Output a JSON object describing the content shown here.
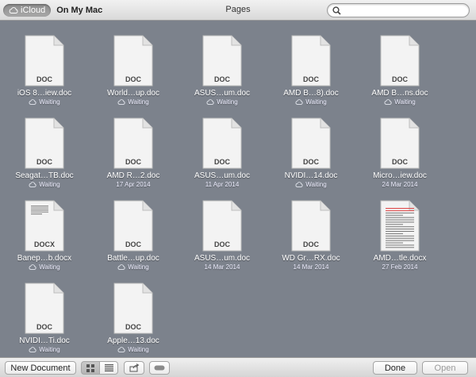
{
  "header": {
    "sources": [
      "iCloud",
      "On My Mac"
    ],
    "title": "Pages",
    "search_placeholder": ""
  },
  "documents": [
    {
      "name": "iOS 8…iew.doc",
      "ext": "DOC",
      "status": "Waiting",
      "cloud": true
    },
    {
      "name": "World…up.doc",
      "ext": "DOC",
      "status": "Waiting",
      "cloud": true
    },
    {
      "name": "ASUS…um.doc",
      "ext": "DOC",
      "status": "Waiting",
      "cloud": true
    },
    {
      "name": "AMD B…8).doc",
      "ext": "DOC",
      "status": "Waiting",
      "cloud": true
    },
    {
      "name": "AMD B…ns.doc",
      "ext": "DOC",
      "status": "Waiting",
      "cloud": true
    },
    {
      "name": "Seagat…TB.doc",
      "ext": "DOC",
      "status": "Waiting",
      "cloud": true
    },
    {
      "name": "AMD R…2.doc",
      "ext": "DOC",
      "status": "17 Apr 2014",
      "cloud": false
    },
    {
      "name": "ASUS…um.doc",
      "ext": "DOC",
      "status": "11 Apr 2014",
      "cloud": false
    },
    {
      "name": "NVIDI…14.doc",
      "ext": "DOC",
      "status": "Waiting",
      "cloud": true
    },
    {
      "name": "Micro…iew.doc",
      "ext": "DOC",
      "status": "24 Mar 2014",
      "cloud": false
    },
    {
      "name": "Banep…b.docx",
      "ext": "DOCX",
      "status": "Waiting",
      "cloud": true,
      "preview": "lines-top"
    },
    {
      "name": "Battle…up.doc",
      "ext": "DOC",
      "status": "Waiting",
      "cloud": true
    },
    {
      "name": "ASUS…um.doc",
      "ext": "DOC",
      "status": "14 Mar 2014",
      "cloud": false
    },
    {
      "name": "WD Gr…RX.doc",
      "ext": "DOC",
      "status": "14 Mar 2014",
      "cloud": false
    },
    {
      "name": "AMD…tle.docx",
      "ext": "",
      "status": "27 Feb 2014",
      "cloud": false,
      "preview": "full-page"
    },
    {
      "name": "NVIDI…Ti.doc",
      "ext": "DOC",
      "status": "Waiting",
      "cloud": true
    },
    {
      "name": "Apple…13.doc",
      "ext": "DOC",
      "status": "Waiting",
      "cloud": true
    }
  ],
  "footer": {
    "new_document": "New Document",
    "done": "Done",
    "open": "Open",
    "icons": [
      "grid-view-icon",
      "list-view-icon",
      "share-icon",
      "tag-icon"
    ]
  },
  "colors": {
    "background": "#7c828c",
    "bar": "#e5e5e5",
    "doc": "#f2f2f2"
  }
}
